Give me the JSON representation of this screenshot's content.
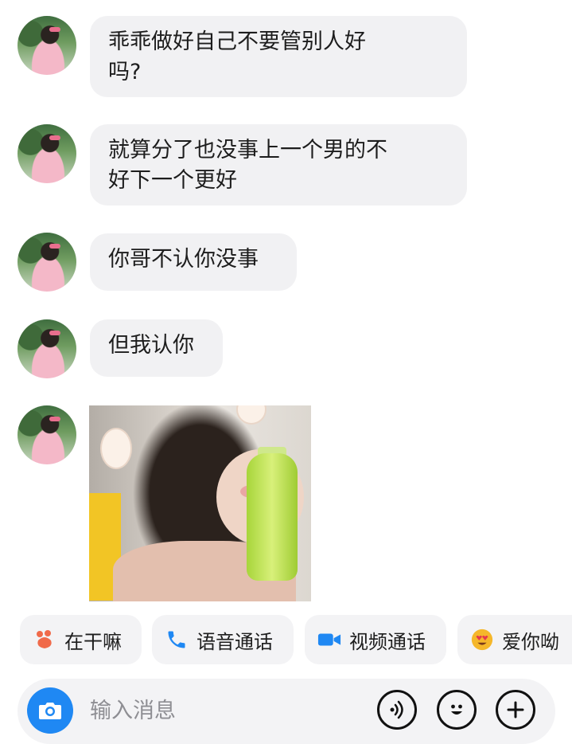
{
  "messages": [
    {
      "text": "乖乖做好自己不要管别人好\n吗?"
    },
    {
      "text": "就算分了也没事上一个男的不\n好下一个更好"
    },
    {
      "text": "你哥不认你没事"
    },
    {
      "text": "但我认你"
    }
  ],
  "quick_replies": [
    {
      "label": "在干嘛",
      "icon": "paw-icon",
      "color": "#f06a4a"
    },
    {
      "label": "语音通话",
      "icon": "phone-icon",
      "color": "#1f88f3"
    },
    {
      "label": "视频通话",
      "icon": "video-camera-icon",
      "color": "#1f88f3"
    },
    {
      "label": "爱你呦",
      "icon": "heart-eyes-emoji-icon",
      "color": "#f5b72a"
    }
  ],
  "input": {
    "placeholder": "输入消息"
  },
  "colors": {
    "accent": "#1f88f3",
    "bubble": "#f1f1f3"
  }
}
